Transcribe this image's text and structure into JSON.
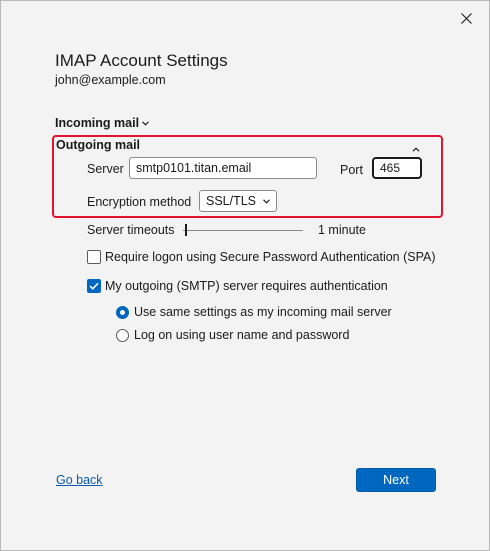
{
  "dialog": {
    "title": "IMAP Account Settings",
    "email": "john@example.com",
    "close_icon": "close-icon"
  },
  "incoming": {
    "label": "Incoming mail",
    "chevron_icon": "chevron-down-icon"
  },
  "outgoing": {
    "label": "Outgoing mail",
    "collapse_icon": "chevron-up-icon",
    "server_label": "Server",
    "server_value": "smtp0101.titan.email",
    "port_label": "Port",
    "port_value": "465",
    "encryption_label": "Encryption method",
    "encryption_value": "SSL/TLS"
  },
  "timeouts": {
    "label": "Server timeouts",
    "value": "1 minute"
  },
  "options": {
    "spa_label": "Require logon using Secure Password Authentication (SPA)",
    "spa_checked": false,
    "smtp_auth_label": "My outgoing (SMTP) server requires authentication",
    "smtp_auth_checked": true,
    "radio_same_label": "Use same settings as my incoming mail server",
    "radio_login_label": "Log on using user name and password",
    "selected_radio": "same"
  },
  "footer": {
    "back_label": "Go back",
    "next_label": "Next"
  },
  "colors": {
    "accent": "#0067c0",
    "highlight": "#e0142d",
    "link": "#0b5cad"
  }
}
